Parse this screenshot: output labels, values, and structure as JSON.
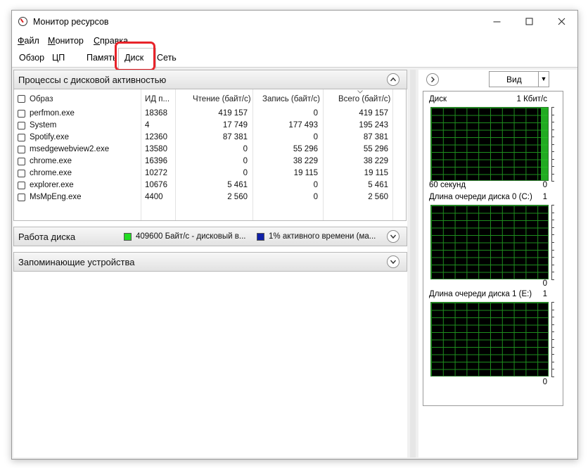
{
  "window": {
    "title": "Монитор ресурсов",
    "min_icon": "minimize-icon",
    "max_icon": "maximize-icon",
    "close_icon": "close-icon"
  },
  "menu": [
    {
      "label": "Файл",
      "accel": "Ф",
      "rest": "айл"
    },
    {
      "label": "Монитор",
      "accel": "М",
      "rest": "онитор"
    },
    {
      "label": "Справка",
      "accel": "С",
      "rest": "правка"
    }
  ],
  "tabs": {
    "overview": "Обзор",
    "cpu": "ЦП",
    "memory": "Память",
    "disk": "Диск",
    "network": "Сеть",
    "active": "Диск"
  },
  "processes": {
    "title": "Процессы с дисковой активностью",
    "columns": [
      "Образ",
      "ИД п...",
      "Чтение (байт/с)",
      "Запись (байт/с)",
      "Всего (байт/с)"
    ],
    "rows": [
      {
        "image": "perfmon.exe",
        "pid": "18368",
        "read": "419 157",
        "write": "0",
        "total": "419 157"
      },
      {
        "image": "System",
        "pid": "4",
        "read": "17 749",
        "write": "177 493",
        "total": "195 243"
      },
      {
        "image": "Spotify.exe",
        "pid": "12360",
        "read": "87 381",
        "write": "0",
        "total": "87 381"
      },
      {
        "image": "msedgewebview2.exe",
        "pid": "13580",
        "read": "0",
        "write": "55 296",
        "total": "55 296"
      },
      {
        "image": "chrome.exe",
        "pid": "16396",
        "read": "0",
        "write": "38 229",
        "total": "38 229"
      },
      {
        "image": "chrome.exe",
        "pid": "10272",
        "read": "0",
        "write": "19 115",
        "total": "19 115"
      },
      {
        "image": "explorer.exe",
        "pid": "10676",
        "read": "5 461",
        "write": "0",
        "total": "5 461"
      },
      {
        "image": "MsMpEng.exe",
        "pid": "4400",
        "read": "2 560",
        "write": "0",
        "total": "2 560"
      }
    ]
  },
  "disk_activity": {
    "title": "Работа диска",
    "legend1": "409600 Байт/с - дисковый в...",
    "legend2": "1% активного времени (ма...",
    "color1": "#22dd22",
    "color2": "#1020a8"
  },
  "storage": {
    "title": "Запоминающие устройства"
  },
  "right": {
    "view_label": "Вид",
    "graphs": [
      {
        "title": "Диск",
        "max": "1 Кбит/с",
        "min": "0",
        "footer": "60 секунд",
        "activity_fraction": 0.06
      },
      {
        "title": "Длина очереди диска 0 (C:)",
        "max": "1",
        "min": "0"
      },
      {
        "title": "Длина очереди диска 1 (E:)",
        "max": "1",
        "min": "0"
      }
    ]
  }
}
